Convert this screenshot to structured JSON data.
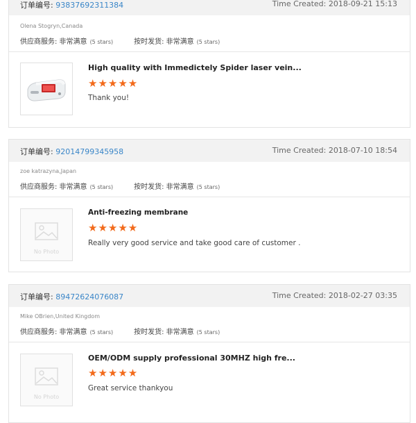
{
  "labels": {
    "order_prefix": "订单编号: ",
    "time_prefix": "Time Created: ",
    "supplier_service": "供应商服务: 非常满意",
    "on_time": "按时发货: 非常满意",
    "five_stars": "(5 stars)",
    "stars": "★★★★★",
    "no_photo": "No Photo"
  },
  "colors": {
    "accent_link": "#3a86c8",
    "star": "#f26a1b"
  },
  "reviews": [
    {
      "order_no": "93837692311384",
      "time_created": "2018-09-21 15:13",
      "reviewer": "Olena Stogryn,Canada",
      "product_title": "High quality with Immedictely Spider laser vein...",
      "rating": 5,
      "comment": "Thank you!",
      "has_photo": true
    },
    {
      "order_no": "92014799345958",
      "time_created": "2018-07-10 18:54",
      "reviewer": "zoe katrazyna,Japan",
      "product_title": "Anti-freezing membrane",
      "rating": 5,
      "comment": "Really very good service and take good care of customer .",
      "has_photo": false
    },
    {
      "order_no": "89472624076087",
      "time_created": "2018-02-27 03:35",
      "reviewer": "Mike OBrien,United Kingdom",
      "product_title": "OEM/ODM supply professional 30MHZ high fre...",
      "rating": 5,
      "comment": "Great service thankyou",
      "has_photo": false
    }
  ]
}
